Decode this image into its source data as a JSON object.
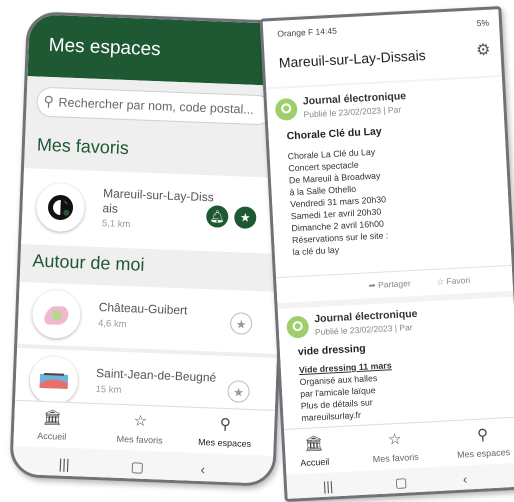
{
  "left": {
    "header_title": "Mes espaces",
    "search_placeholder": "Rechercher par nom, code postal...",
    "favorites_title": "Mes favoris",
    "favorite": {
      "name_line1": "Mareuil-sur-Lay-Diss",
      "name_line2": "ais",
      "distance": "5,1 km"
    },
    "nearby_title": "Autour de moi",
    "nearby": [
      {
        "name": "Château-Guibert",
        "distance": "4,6 km"
      },
      {
        "name": "Saint-Jean-de-Beugné",
        "distance": "15 km"
      }
    ],
    "nav": [
      "Accueil",
      "Mes favoris",
      "Mes espaces"
    ]
  },
  "right": {
    "status_left": "Orange F 14:45",
    "status_right": "5%",
    "title": "Mareuil-sur-Lay-Dissais",
    "posts": [
      {
        "from": "Journal électronique",
        "date": "Publié le 23/02/2023 | Par",
        "title": "Chorale Clé du Lay",
        "lines": [
          "Chorale La Clé du Lay",
          "Concert spectacle",
          "De Mareuil à Broadway",
          "à la Salle Othello",
          "Vendredi 31 mars 20h30",
          "Samedi 1er avril 20h30",
          "Dimanche 2 avril 16h00",
          "Réservations sur le site :",
          "la clé du lay"
        ],
        "share": "Partager",
        "fav": "Favori"
      },
      {
        "from": "Journal électronique",
        "date": "Publié le 23/02/2023 | Par",
        "title": "vide dressing",
        "underline": "Vide dressing 11 mars",
        "lines": [
          "Organisé aux halles",
          "par l'amicale laïque",
          "Plus de détails sur",
          "mareuilsurlay.fr"
        ]
      }
    ],
    "nav": [
      "Accueil",
      "Mes favoris",
      "Mes espaces"
    ]
  }
}
